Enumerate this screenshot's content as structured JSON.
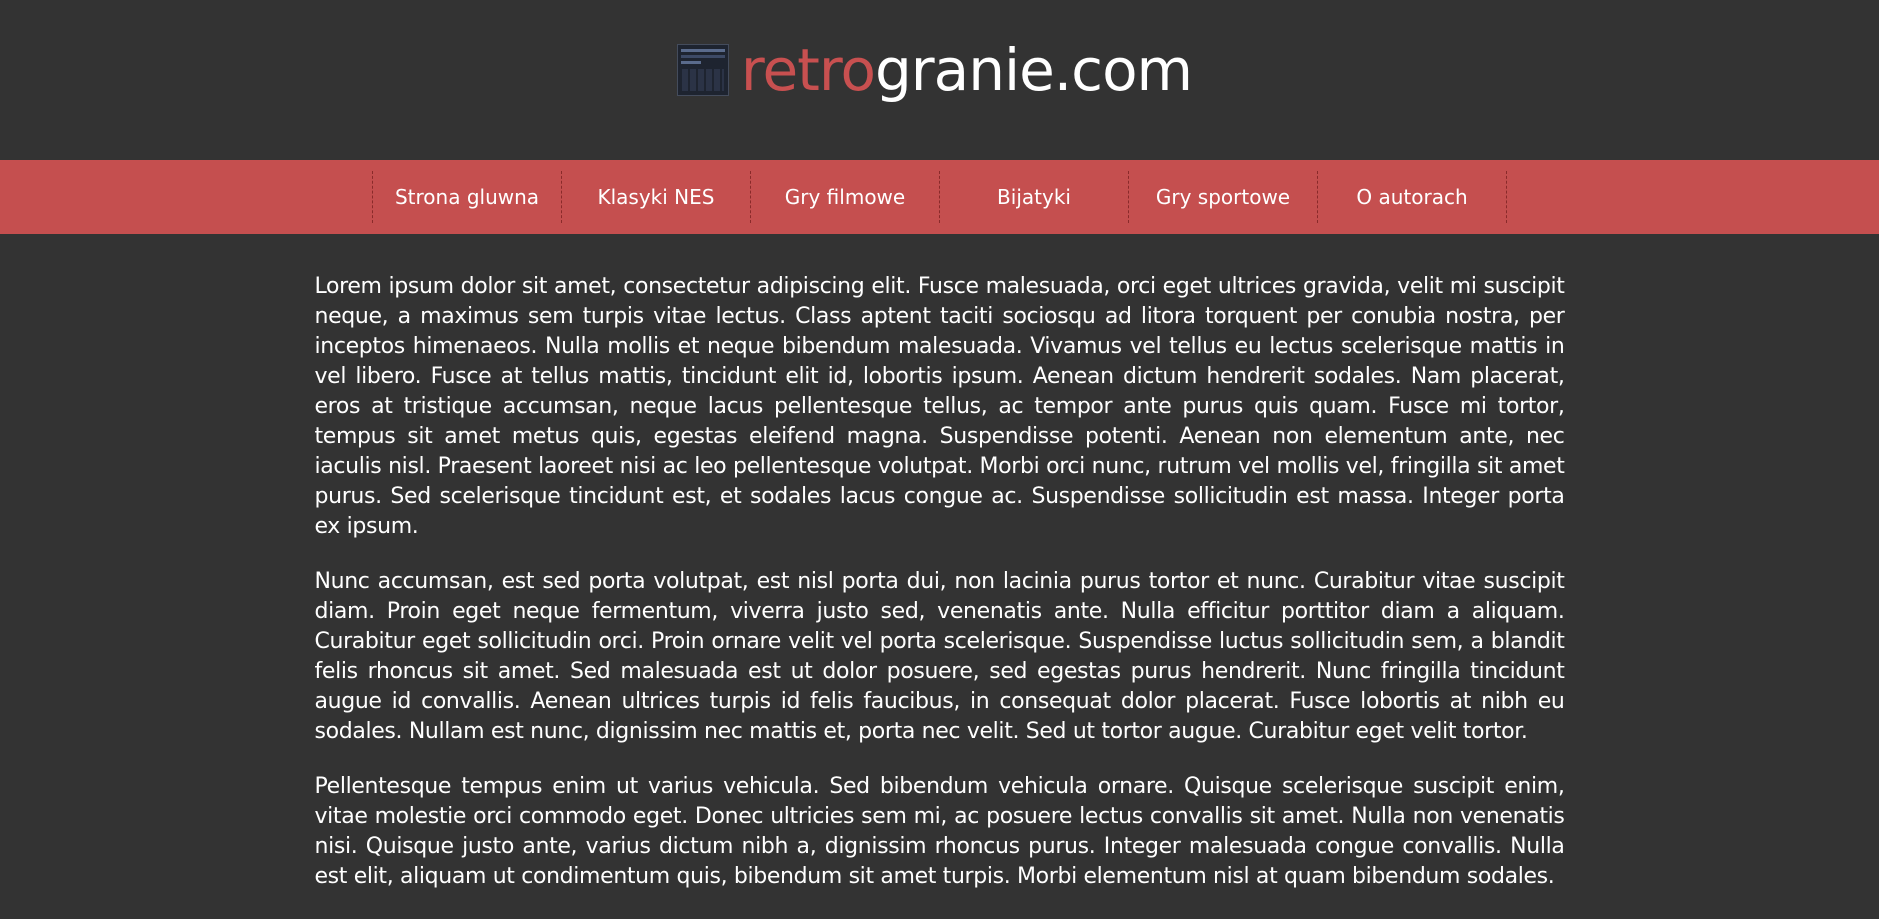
{
  "logo": {
    "retro": "retro",
    "rest": "granie.com"
  },
  "nav": {
    "items": [
      {
        "label": "Strona gluwna"
      },
      {
        "label": "Klasyki NES"
      },
      {
        "label": "Gry filmowe"
      },
      {
        "label": "Bijatyki"
      },
      {
        "label": "Gry sportowe"
      },
      {
        "label": "O autorach"
      }
    ]
  },
  "content": {
    "paragraphs": [
      "Lorem ipsum dolor sit amet, consectetur adipiscing elit. Fusce malesuada, orci eget ultrices gravida, velit mi suscipit neque, a maximus sem turpis vitae lectus. Class aptent taciti sociosqu ad litora torquent per conubia nostra, per inceptos himenaeos. Nulla mollis et neque bibendum malesuada. Vivamus vel tellus eu lectus scelerisque mattis in vel libero. Fusce at tellus mattis, tincidunt elit id, lobortis ipsum. Aenean dictum hendrerit sodales. Nam placerat, eros at tristique accumsan, neque lacus pellentesque tellus, ac tempor ante purus quis quam. Fusce mi tortor, tempus sit amet metus quis, egestas eleifend magna. Suspendisse potenti. Aenean non elementum ante, nec iaculis nisl. Praesent laoreet nisi ac leo pellentesque volutpat. Morbi orci nunc, rutrum vel mollis vel, fringilla sit amet purus. Sed scelerisque tincidunt est, et sodales lacus congue ac. Suspendisse sollicitudin est massa. Integer porta ex ipsum.",
      "Nunc accumsan, est sed porta volutpat, est nisl porta dui, non lacinia purus tortor et nunc. Curabitur vitae suscipit diam. Proin eget neque fermentum, viverra justo sed, venenatis ante. Nulla efficitur porttitor diam a aliquam. Curabitur eget sollicitudin orci. Proin ornare velit vel porta scelerisque. Suspendisse luctus sollicitudin sem, a blandit felis rhoncus sit amet. Sed malesuada est ut dolor posuere, sed egestas purus hendrerit. Nunc fringilla tincidunt augue id convallis. Aenean ultrices turpis id felis faucibus, in consequat dolor placerat. Fusce lobortis at nibh eu sodales. Nullam est nunc, dignissim nec mattis et, porta nec velit. Sed ut tortor augue. Curabitur eget velit tortor.",
      "Pellentesque tempus enim ut varius vehicula. Sed bibendum vehicula ornare. Quisque scelerisque suscipit enim, vitae molestie orci commodo eget. Donec ultricies sem mi, ac posuere lectus convallis sit amet. Nulla non venenatis nisi. Quisque justo ante, varius dictum nibh a, dignissim rhoncus purus. Integer malesuada congue convallis. Nulla est elit, aliquam ut condimentum quis, bibendum sit amet turpis. Morbi elementum nisl at quam bibendum sodales."
    ]
  },
  "colors": {
    "background": "#333333",
    "accent": "#c54f4f",
    "logo_retro": "#c85050"
  }
}
